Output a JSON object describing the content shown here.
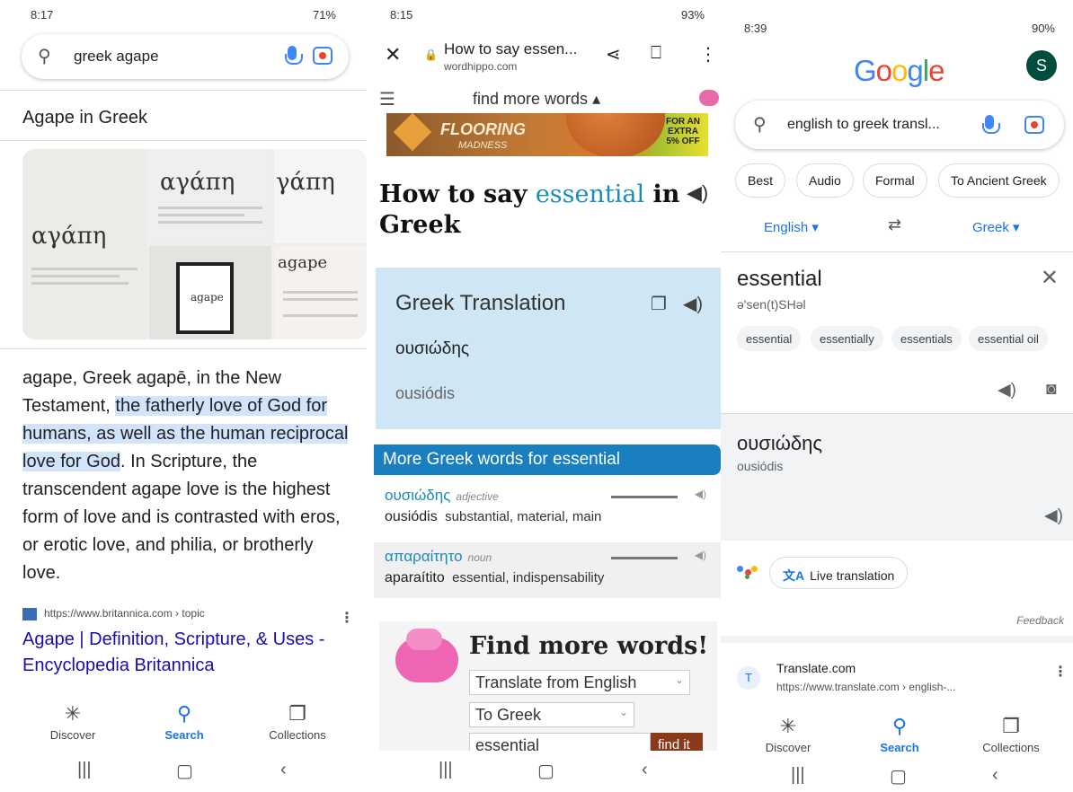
{
  "panel1": {
    "status": {
      "time": "8:17",
      "right": "71%"
    },
    "search": {
      "query": "greek agape"
    },
    "kp_title": "Agape in Greek",
    "image_words": [
      "αγάπη",
      "αγάπη",
      "γάπη",
      "agape",
      "agape"
    ],
    "body": {
      "p1": "agape, Greek agapē, in the New Testament, ",
      "highlight": "the fatherly love of God for humans, as well as the human reciprocal love for God",
      "p2": ". In Scripture, the transcendent agape love is the highest form of love and is contrasted with eros, or erotic love, and philia, or brotherly love."
    },
    "source": "https://www.britannica.com › topic",
    "link": "Agape | Definition, Scripture, & Uses - Encyclopedia Britannica",
    "tabs": {
      "discover": "Discover",
      "search": "Search",
      "collections": "Collections"
    }
  },
  "panel2": {
    "status": {
      "time": "8:15",
      "right": "93%"
    },
    "tab_title": "How to say essen...",
    "url": "wordhippo.com",
    "find_more": "find more words",
    "ad": {
      "line1": "FLOORING",
      "line2": "MADNESS",
      "badge": "FOR AN EXTRA 5% OFF"
    },
    "heading_a": "How to say ",
    "heading_em": "essential",
    "heading_b": " in Greek",
    "gt_title": "Greek Translation",
    "gt_word": "ουσιώδης",
    "gt_roman": "ousiódis",
    "more_title": "More Greek words for essential",
    "rows": [
      {
        "greek": "ουσιώδης",
        "pos": "adjective",
        "roman": "ousiódis",
        "meaning": "substantial, material, main"
      },
      {
        "greek": "απαραίτητο",
        "pos": "noun",
        "roman": "aparaítito",
        "meaning": "essential, indispensability"
      }
    ],
    "fm_title": "Find more words!",
    "fm_from": "Translate from English",
    "fm_to": "To Greek",
    "fm_input": "essential",
    "fm_button": "find it"
  },
  "panel3": {
    "status": {
      "time": "8:39",
      "right": "90%"
    },
    "avatar": "S",
    "search": {
      "query": "english to greek transl..."
    },
    "chips": [
      "Best",
      "Audio",
      "Formal",
      "To Ancient Greek"
    ],
    "source_lang": "English",
    "target_lang": "Greek",
    "src_word": "essential",
    "src_phonetic": "ə'sen(t)SHəl",
    "suggestions": [
      "essential",
      "essentially",
      "essentials",
      "essential oil"
    ],
    "tgt_word": "ουσιώδης",
    "tgt_roman": "ousiódis",
    "live": "Live translation",
    "feedback": "Feedback",
    "result_name": "Translate.com",
    "result_url": "https://www.translate.com › english-...",
    "tabs": {
      "discover": "Discover",
      "search": "Search",
      "collections": "Collections"
    }
  }
}
